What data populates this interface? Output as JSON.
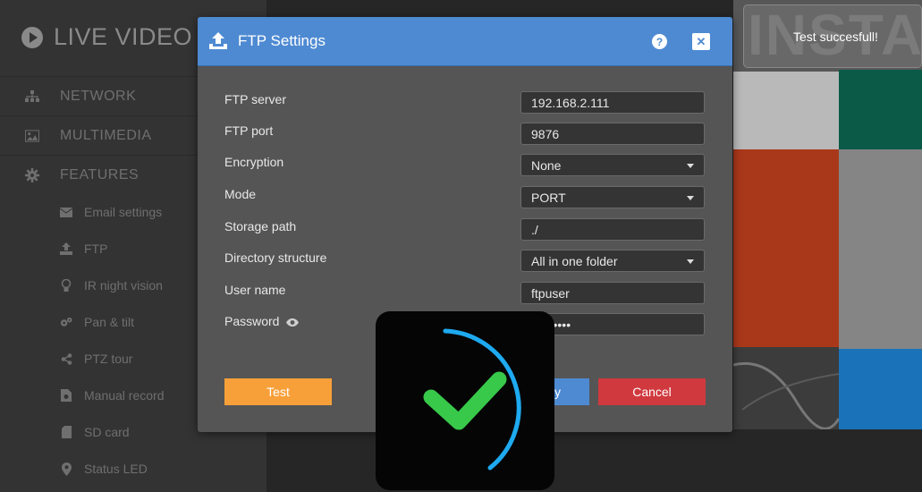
{
  "app": {
    "title": "LIVE VIDEO"
  },
  "sidebar": {
    "main_items": [
      {
        "label": "NETWORK",
        "icon": "network-icon"
      },
      {
        "label": "MULTIMEDIA",
        "icon": "image-icon"
      },
      {
        "label": "FEATURES",
        "icon": "gear-icon"
      }
    ],
    "sub_items": [
      {
        "label": "Email settings",
        "icon": "envelope-icon"
      },
      {
        "label": "FTP",
        "icon": "upload-icon"
      },
      {
        "label": "IR night vision",
        "icon": "lightbulb-icon"
      },
      {
        "label": "Pan & tilt",
        "icon": "gears-icon"
      },
      {
        "label": "PTZ tour",
        "icon": "share-icon"
      },
      {
        "label": "Manual record",
        "icon": "record-file-icon"
      },
      {
        "label": "SD card",
        "icon": "sd-card-icon"
      },
      {
        "label": "Status LED",
        "icon": "map-marker-icon"
      }
    ]
  },
  "modal": {
    "title": "FTP Settings",
    "help_label": "?",
    "close_label": "✕",
    "fields": [
      {
        "label": "FTP server",
        "value": "192.168.2.111",
        "type": "text"
      },
      {
        "label": "FTP port",
        "value": "9876",
        "type": "text"
      },
      {
        "label": "Encryption",
        "value": "None",
        "type": "select"
      },
      {
        "label": "Mode",
        "value": "PORT",
        "type": "select"
      },
      {
        "label": "Storage path",
        "value": "./",
        "type": "text"
      },
      {
        "label": "Directory structure",
        "value": "All in one folder",
        "type": "select"
      },
      {
        "label": "User name",
        "value": "ftpuser",
        "type": "text"
      },
      {
        "label": "Password",
        "value": "•••••••••",
        "type": "password"
      }
    ],
    "buttons": {
      "test": "Test",
      "apply": "Apply",
      "cancel": "Cancel"
    }
  },
  "toast": {
    "message": "Test succesfull!",
    "watermark": "INSTAR"
  },
  "colors": {
    "header_blue": "#4e8ad2",
    "test_orange": "#f7a03a",
    "cancel_red": "#d0393e",
    "success_green": "#38c94a",
    "spinner_blue": "#1eaaf0"
  }
}
